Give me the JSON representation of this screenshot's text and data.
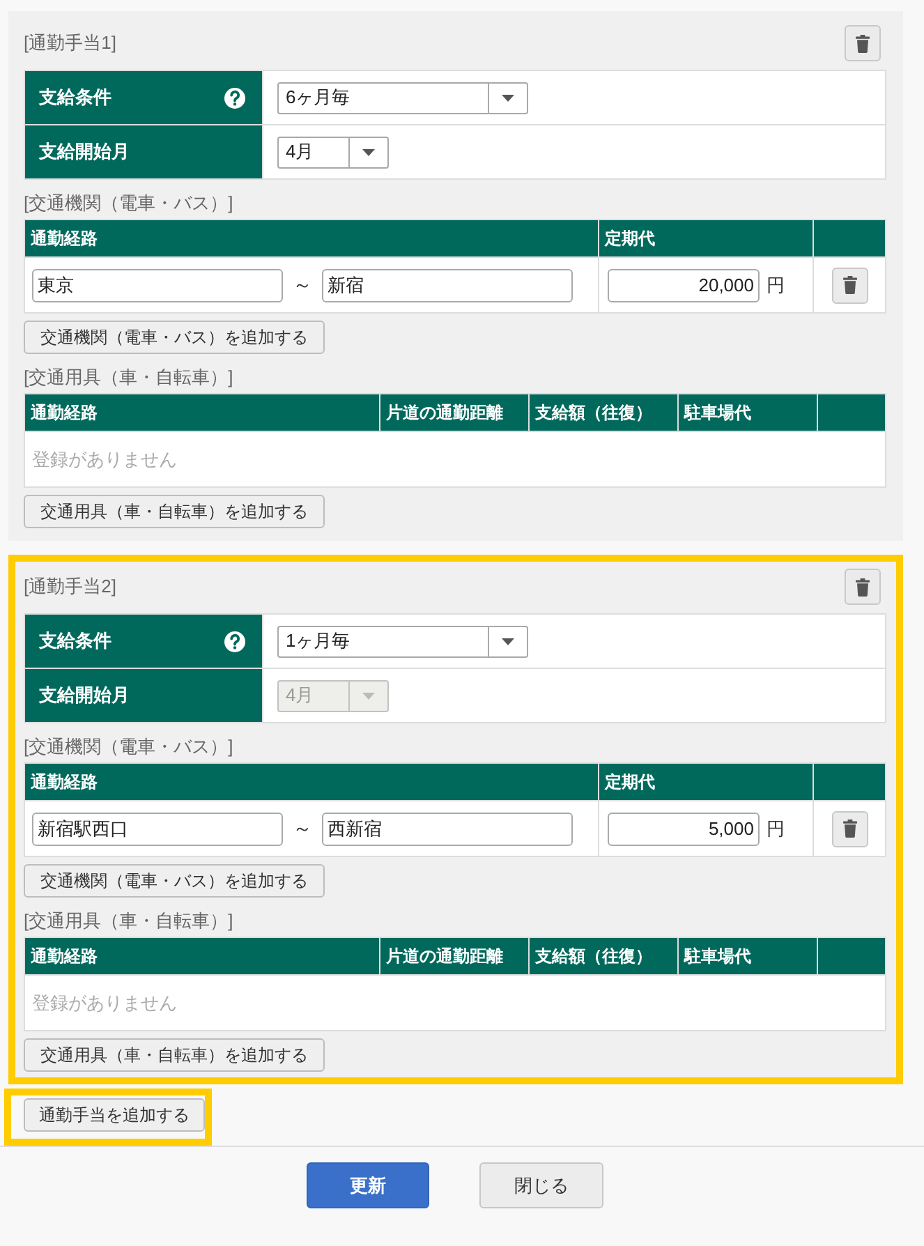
{
  "sections": [
    {
      "title": "[通勤手当1]",
      "highlighted": false,
      "settings": [
        {
          "label": "支給条件",
          "help": true,
          "select": {
            "value": "6ヶ月毎",
            "disabled": false
          }
        },
        {
          "label": "支給開始月",
          "help": false,
          "select": {
            "value": "4月",
            "disabled": false
          }
        }
      ],
      "transit": {
        "heading": "[交通機関（電車・バス）]",
        "columns": [
          "通勤経路",
          "定期代"
        ],
        "rows": [
          {
            "from": "東京",
            "separator": "～",
            "to": "新宿",
            "fare": "20,000",
            "unit": "円"
          }
        ],
        "add_button": "交通機関（電車・バス）を追加する"
      },
      "vehicle": {
        "heading": "[交通用具（車・自転車）]",
        "columns": [
          "通勤経路",
          "片道の通勤距離",
          "支給額（往復）",
          "駐車場代"
        ],
        "empty_message": "登録がありません",
        "add_button": "交通用具（車・自転車）を追加する"
      }
    },
    {
      "title": "[通勤手当2]",
      "highlighted": true,
      "settings": [
        {
          "label": "支給条件",
          "help": true,
          "select": {
            "value": "1ヶ月毎",
            "disabled": false
          }
        },
        {
          "label": "支給開始月",
          "help": false,
          "select": {
            "value": "4月",
            "disabled": true
          }
        }
      ],
      "transit": {
        "heading": "[交通機関（電車・バス）]",
        "columns": [
          "通勤経路",
          "定期代"
        ],
        "rows": [
          {
            "from": "新宿駅西口",
            "separator": "～",
            "to": "西新宿",
            "fare": "5,000",
            "unit": "円"
          }
        ],
        "add_button": "交通機関（電車・バス）を追加する"
      },
      "vehicle": {
        "heading": "[交通用具（車・自転車）]",
        "columns": [
          "通勤経路",
          "片道の通勤距離",
          "支給額（往復）",
          "駐車場代"
        ],
        "empty_message": "登録がありません",
        "add_button": "交通用具（車・自転車）を追加する"
      }
    }
  ],
  "add_section": {
    "label": "通勤手当を追加する",
    "highlighted": true
  },
  "footer": {
    "buttons": [
      {
        "label": "更新",
        "kind": "primary"
      },
      {
        "label": "閉じる",
        "kind": "secondary"
      }
    ]
  }
}
